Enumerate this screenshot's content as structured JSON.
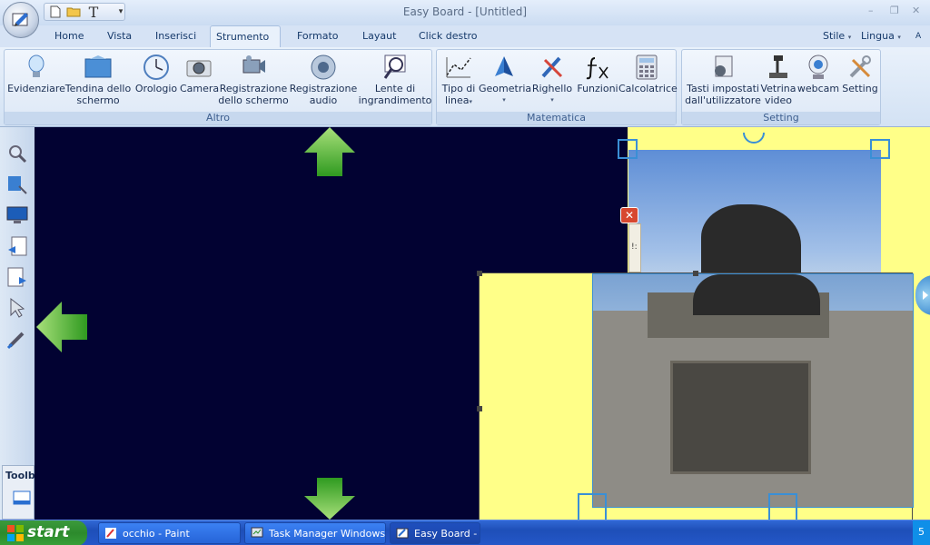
{
  "app": {
    "title": "Easy Board - [Untitled]"
  },
  "quick_access": {
    "text_tool": "T",
    "dropdown": "▾"
  },
  "window_controls": {
    "minimize": "–",
    "restore": "❐",
    "close": "✕"
  },
  "tabs": [
    {
      "label": "Home"
    },
    {
      "label": "Vista"
    },
    {
      "label": "Inserisci"
    },
    {
      "label": "Strumento"
    },
    {
      "label": "Formato"
    },
    {
      "label": "Layaut"
    },
    {
      "label": "Click destro"
    }
  ],
  "top_right": {
    "style": "Stile",
    "language": "Lingua",
    "caret": "▾",
    "fa": "A"
  },
  "ribbon": {
    "groups": [
      {
        "title": "Altro"
      },
      {
        "title": "Matematica"
      },
      {
        "title": "Setting"
      }
    ],
    "altro": [
      {
        "line1": "Evidenziare",
        "line2": ""
      },
      {
        "line1": "Tendina dello",
        "line2": "schermo"
      },
      {
        "line1": "Orologio",
        "line2": ""
      },
      {
        "line1": "Camera",
        "line2": ""
      },
      {
        "line1": "Registrazione",
        "line2": "dello schermo"
      },
      {
        "line1": "Registrazione",
        "line2": "audio"
      },
      {
        "line1": "Lente di",
        "line2": "ingrandimento"
      }
    ],
    "matematica": [
      {
        "line1": "Tipo di",
        "line2": "linea"
      },
      {
        "line1": "Geometria",
        "line2": ""
      },
      {
        "line1": "Righello",
        "line2": ""
      },
      {
        "line1": "Funzioni",
        "line2": ""
      },
      {
        "line1": "Calcolatrice",
        "line2": ""
      }
    ],
    "setting": [
      {
        "line1": "Tasti impostati",
        "line2": "dall'utilizzatore"
      },
      {
        "line1": "Vetrina",
        "line2": "video"
      },
      {
        "line1": "webcam",
        "line2": ""
      },
      {
        "line1": "Setting",
        "line2": ""
      }
    ],
    "caret": "▾"
  },
  "toolbox": {
    "label": "Toolba"
  },
  "dialog": {
    "close": "✕",
    "partial_text": "!:"
  },
  "zoom": {
    "in": "+",
    "out": "−",
    "close": "✕"
  },
  "taskbar": {
    "start_label": "start",
    "tasks": [
      {
        "label": "occhio - Paint"
      },
      {
        "label": "Task Manager Windows"
      },
      {
        "label": "Easy Board - ["
      }
    ],
    "tray_text": "5"
  },
  "colors": {
    "canvas_bg": "#020232",
    "yellow_panel": "#ffff88",
    "selection": "#3a8fd6",
    "arrow_green": "#4bb33a"
  }
}
